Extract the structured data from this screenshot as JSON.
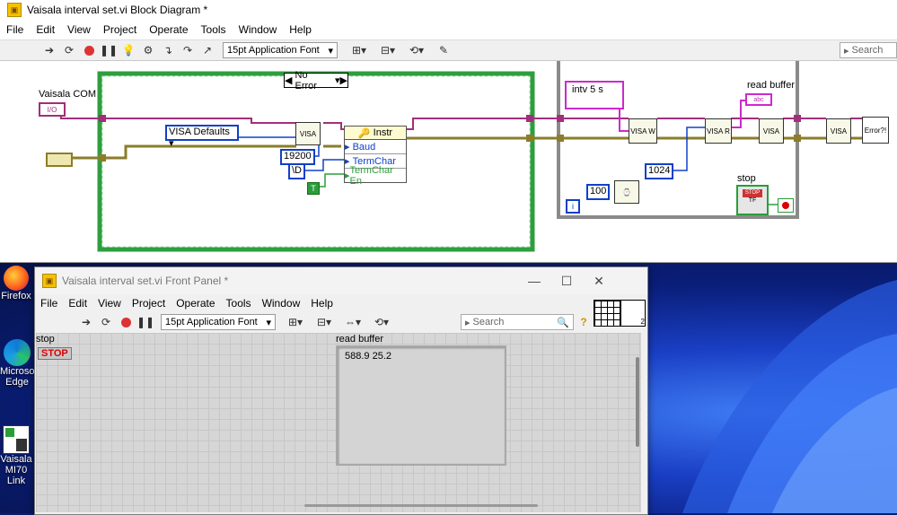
{
  "block_diagram": {
    "title": "Vaisala interval set.vi Block Diagram *",
    "menu": [
      "File",
      "Edit",
      "View",
      "Project",
      "Operate",
      "Tools",
      "Window",
      "Help"
    ],
    "font_select": "15pt Application Font",
    "search_placeholder": "Search",
    "labels": {
      "vaisala_com": "Vaisala COM",
      "no_error": "No Error",
      "visa_defaults": "VISA Defaults",
      "instr": "Instr",
      "baud": "Baud",
      "termchar": "TermChar",
      "termchar_en": "TermChar En",
      "baud_value": "19200",
      "termchar_value": "\\D",
      "intv": "intv 5 s",
      "read_buffer": "read buffer",
      "read_count": "1024",
      "wait_ms": "100",
      "stop": "stop",
      "true_const": "T",
      "loop_index": "i",
      "stop_btn": "STOP",
      "stop_btn_sub": "TF",
      "io_tag": "I/O"
    }
  },
  "front_panel": {
    "title": "Vaisala interval set.vi Front Panel *",
    "menu": [
      "File",
      "Edit",
      "View",
      "Project",
      "Operate",
      "Tools",
      "Window",
      "Help"
    ],
    "font_select": "15pt Application Font",
    "search_placeholder": "Search",
    "stop_label": "stop",
    "stop_button": "STOP",
    "read_buffer_label": "read buffer",
    "read_buffer_value": "588.9  25.2",
    "connector_count": "2"
  },
  "desktop": {
    "icons": [
      "Firefox",
      "Microsoft Edge",
      "Vaisala MI70 Link"
    ]
  }
}
